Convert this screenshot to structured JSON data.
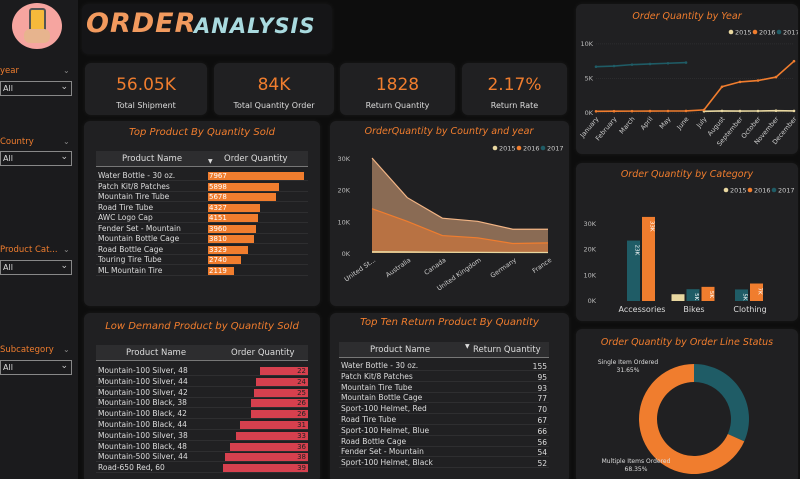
{
  "header": {
    "title_part1": "ORDER",
    "title_part2": "ANALYSIS"
  },
  "colors": {
    "accent": "#f07d2e",
    "series_2015": "#e8d7a0",
    "series_2016": "#f07d2e",
    "series_2017": "#1f5c66",
    "low_demand": "#d6404e"
  },
  "slicers": [
    {
      "label": "year",
      "value": "All"
    },
    {
      "label": "Country",
      "value": "All"
    },
    {
      "label": "Product Cat...",
      "value": "All"
    },
    {
      "label": "Subcategory",
      "value": "All"
    }
  ],
  "kpis": [
    {
      "value": "56.05K",
      "label": "Total Shipment"
    },
    {
      "value": "84K",
      "label": "Total Quantity Order"
    },
    {
      "value": "1828",
      "label": "Return Quantity"
    },
    {
      "value": "2.17%",
      "label": "Return Rate"
    }
  ],
  "top_product": {
    "title": "Top Product By Quantity Sold",
    "col1": "Product Name",
    "col2": "Order Quantity",
    "rows": [
      {
        "name": "Water Bottle - 30 oz.",
        "qty": 7967
      },
      {
        "name": "Patch Kit/8 Patches",
        "qty": 5898
      },
      {
        "name": "Mountain Tire Tube",
        "qty": 5678
      },
      {
        "name": "Road Tire Tube",
        "qty": 4327
      },
      {
        "name": "AWC Logo Cap",
        "qty": 4151
      },
      {
        "name": "Fender Set - Mountain",
        "qty": 3960
      },
      {
        "name": "Mountain Bottle Cage",
        "qty": 3810
      },
      {
        "name": "Road Bottle Cage",
        "qty": 3329
      },
      {
        "name": "Touring Tire Tube",
        "qty": 2740
      },
      {
        "name": "ML Mountain Tire",
        "qty": 2119
      }
    ]
  },
  "low_demand": {
    "title": "Low Demand Product by Quantity Sold",
    "col1": "Product Name",
    "col2": "Order Quantity",
    "rows": [
      {
        "name": "Mountain-100 Silver, 48",
        "qty": 22
      },
      {
        "name": "Mountain-100 Silver, 44",
        "qty": 24
      },
      {
        "name": "Mountain-100 Silver, 42",
        "qty": 25
      },
      {
        "name": "Mountain-100 Black, 38",
        "qty": 26
      },
      {
        "name": "Mountain-100 Black, 42",
        "qty": 26
      },
      {
        "name": "Mountain-100 Black, 44",
        "qty": 31
      },
      {
        "name": "Mountain-100 Silver, 38",
        "qty": 33
      },
      {
        "name": "Mountain-100 Black, 48",
        "qty": 36
      },
      {
        "name": "Mountain-500 Silver, 44",
        "qty": 38
      },
      {
        "name": "Road-650 Red, 60",
        "qty": 39
      }
    ]
  },
  "top_return": {
    "title": "Top Ten Return Product By Quantity",
    "col1": "Product Name",
    "col2": "Return Quantity",
    "rows": [
      {
        "name": "Water Bottle - 30 oz.",
        "qty": "155"
      },
      {
        "name": "Patch Kit/8 Patches",
        "qty": "95"
      },
      {
        "name": "Mountain Tire Tube",
        "qty": "93"
      },
      {
        "name": "Mountain Bottle Cage",
        "qty": "77"
      },
      {
        "name": "Sport-100 Helmet, Red",
        "qty": "70"
      },
      {
        "name": "Road Tire Tube",
        "qty": "67"
      },
      {
        "name": "Sport-100 Helmet, Blue",
        "qty": "66"
      },
      {
        "name": "Road Bottle Cage",
        "qty": "56"
      },
      {
        "name": "Fender Set - Mountain",
        "qty": "54"
      },
      {
        "name": "Sport-100 Helmet, Black",
        "qty": "52"
      }
    ]
  },
  "chart_data": [
    {
      "id": "by_year",
      "type": "line",
      "title": "Order Quantity by Year",
      "legend": [
        "2015",
        "2016",
        "2017"
      ],
      "categories": [
        "January",
        "February",
        "March",
        "April",
        "May",
        "June",
        "July",
        "August",
        "September",
        "October",
        "November",
        "December"
      ],
      "yticks": [
        "0K",
        "5K",
        "10K"
      ],
      "ylim": [
        0,
        11000
      ],
      "series": [
        {
          "name": "2015",
          "values": [
            null,
            null,
            null,
            null,
            null,
            null,
            250,
            300,
            280,
            290,
            330,
            300
          ]
        },
        {
          "name": "2016",
          "values": [
            250,
            260,
            270,
            280,
            290,
            300,
            450,
            3800,
            4500,
            4700,
            5200,
            7500
          ]
        },
        {
          "name": "2017",
          "values": [
            6700,
            6800,
            7000,
            7100,
            7200,
            7300,
            null,
            null,
            null,
            null,
            null,
            null
          ]
        }
      ]
    },
    {
      "id": "by_country",
      "type": "area",
      "title": "OrderQuantity by Country and year",
      "legend": [
        "2015",
        "2016",
        "2017"
      ],
      "categories": [
        "United St...",
        "Australia",
        "Canada",
        "United Kingdom",
        "Germany",
        "France"
      ],
      "yticks": [
        "0K",
        "10K",
        "20K",
        "30K"
      ],
      "ylim": [
        0,
        30000
      ],
      "series": [
        {
          "name": "2015",
          "values": [
            400,
            350,
            250,
            200,
            150,
            150
          ]
        },
        {
          "name": "2016",
          "values": [
            14000,
            10000,
            5500,
            4800,
            3000,
            3200
          ]
        },
        {
          "name": "2017",
          "values": [
            30000,
            17500,
            11000,
            10000,
            7500,
            7500
          ]
        }
      ]
    },
    {
      "id": "by_category",
      "type": "bar",
      "title": "Order Quantity by Category",
      "legend": [
        "2015",
        "2016",
        "2017"
      ],
      "categories": [
        "Accessories",
        "Bikes",
        "Clothing"
      ],
      "yticks": [
        "0K",
        "10K",
        "20K",
        "30K"
      ],
      "ylim": [
        0,
        35000
      ],
      "series": [
        {
          "name": "2015",
          "values": [
            null,
            2630,
            null
          ]
        },
        {
          "name": "2016",
          "values": [
            32700,
            5500,
            6800
          ]
        },
        {
          "name": "2017",
          "values": [
            23500,
            4600,
            4500
          ]
        }
      ],
      "labels": [
        {
          "cat": 0,
          "series": "2017",
          "text": "23K"
        },
        {
          "cat": 0,
          "series": "2016",
          "text": "33K"
        },
        {
          "cat": 1,
          "series": "2017",
          "text": "5K"
        },
        {
          "cat": 1,
          "series": "2016",
          "text": "5K"
        },
        {
          "cat": 2,
          "series": "2017",
          "text": "5K"
        },
        {
          "cat": 2,
          "series": "2016",
          "text": "7K"
        }
      ]
    },
    {
      "id": "by_status",
      "type": "pie",
      "title": "Order Quantity by Order Line Status",
      "slices": [
        {
          "name": "Single Item Ordered",
          "value": 31.65,
          "label": "31.65%"
        },
        {
          "name": "Multiple Items Ordered",
          "value": 68.35,
          "label": "68.35%"
        }
      ]
    }
  ]
}
